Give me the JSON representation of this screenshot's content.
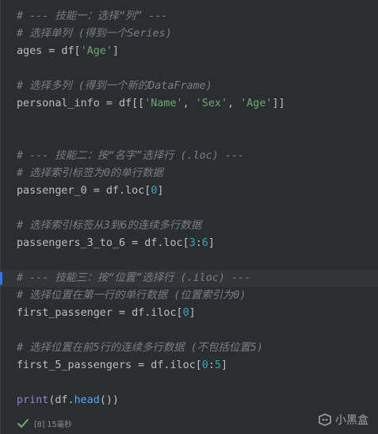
{
  "code": {
    "l1": "# --- 技能一：选择“列” ---",
    "l2": "# 选择单列 (得到一个Series)",
    "l3a": "ages = df[",
    "l3b": "'Age'",
    "l3c": "]",
    "l5": "# 选择多列 (得到一个新的DataFrame)",
    "l6a": "personal_info = df[[",
    "l6b": "'Name'",
    "l6c": ", ",
    "l6d": "'Sex'",
    "l6e": ", ",
    "l6f": "'Age'",
    "l6g": "]]",
    "l9": "# --- 技能二：按“名字”选择行 (.loc) ---",
    "l10": "# 选择索引标签为0的单行数据",
    "l11a": "passenger_0 = df.loc[",
    "l11b": "0",
    "l11c": "]",
    "l13": "# 选择索引标签从3到6的连续多行数据",
    "l14a": "passengers_3_to_6 = df.loc[",
    "l14b": "3",
    "l14c": ":",
    "l14d": "6",
    "l14e": "]",
    "l16": "# --- 技能三：按“位置”选择行 (.iloc) ---",
    "l17": "# 选择位置在第一行的单行数据 (位置索引为0)",
    "l18a": "first_passenger = df.iloc[",
    "l18b": "0",
    "l18c": "]",
    "l20": "# 选择位置在前5行的连续多行数据 (不包括位置5)",
    "l21a": "first_5_passengers = df.iloc[",
    "l21b": "0",
    "l21c": ":",
    "l21d": "5",
    "l21e": "]",
    "l23a": "print",
    "l23b": "(df.",
    "l23c": "head",
    "l23d": "())"
  },
  "status": {
    "icon": "check-icon",
    "text": "[8] 15毫秒",
    "color": "#5fb865"
  },
  "watermark": {
    "text": "小黑盒"
  }
}
